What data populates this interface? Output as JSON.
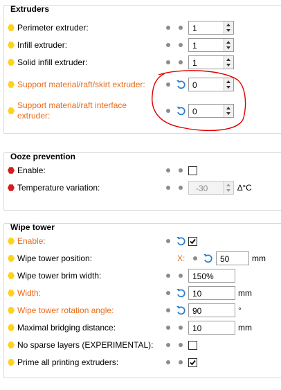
{
  "extruders": {
    "title": "Extruders",
    "perimeter": {
      "label": "Perimeter extruder:",
      "value": "1"
    },
    "infill": {
      "label": "Infill extruder:",
      "value": "1"
    },
    "solid_infill": {
      "label": "Solid infill extruder:",
      "value": "1"
    },
    "support": {
      "label": "Support material/raft/skirt extruder:",
      "value": "0"
    },
    "interface": {
      "label_line1": "Support material/raft interface",
      "label_line2": "extruder:",
      "value": "0"
    }
  },
  "ooze": {
    "title": "Ooze prevention",
    "enable": {
      "label": "Enable:",
      "checked": false
    },
    "temp_variation": {
      "label": "Temperature variation:",
      "value": "-30",
      "unit": "∆°C"
    }
  },
  "wipe": {
    "title": "Wipe tower",
    "enable": {
      "label": "Enable:",
      "checked": true
    },
    "position": {
      "label": "Wipe tower position:",
      "x_label": "X:",
      "value": "50",
      "unit": "mm"
    },
    "brim_width": {
      "label": "Wipe tower brim width:",
      "value": "150%"
    },
    "width": {
      "label": "Width:",
      "value": "10",
      "unit": "mm"
    },
    "rotation": {
      "label": "Wipe tower rotation angle:",
      "value": "90",
      "unit": "°"
    },
    "bridging": {
      "label": "Maximal bridging distance:",
      "value": "10",
      "unit": "mm"
    },
    "no_sparse": {
      "label": "No sparse layers (EXPERIMENTAL):",
      "checked": false
    },
    "prime_all": {
      "label": "Prime all printing extruders:",
      "checked": true
    }
  },
  "colors": {
    "modified_label": "#e96b1a",
    "bullet_required": "#ffd21e",
    "bullet_advanced": "#d81c1c",
    "undo_arrow": "#2a7fd4",
    "annotation": "#e00000"
  },
  "icons": [
    "undo-arrow-icon",
    "checkmark-icon",
    "hexagon-bullet-icon"
  ]
}
